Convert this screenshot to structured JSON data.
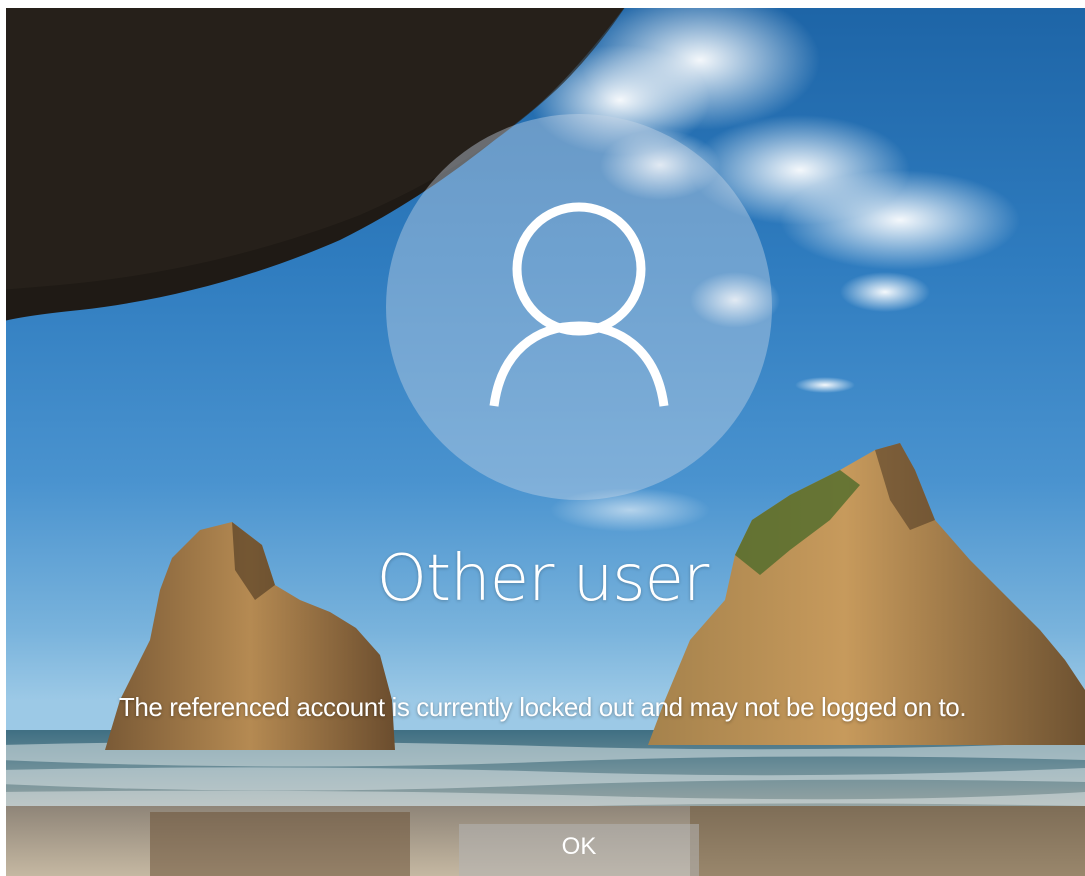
{
  "login": {
    "username": "Other user",
    "message": "The referenced account is currently locked out and may not be logged on to.",
    "ok_label": "OK"
  },
  "icons": {
    "avatar": "user-silhouette-icon"
  },
  "colors": {
    "sky": "#2f7cbf",
    "text": "#ffffff",
    "button": "#b4b4b4"
  }
}
